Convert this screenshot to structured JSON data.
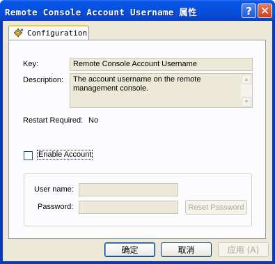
{
  "window": {
    "title": "Remote Console Account Username 属性",
    "help_glyph": "?",
    "close_glyph": "✕"
  },
  "tab": {
    "label": "Configuration",
    "icon": "gear-icon"
  },
  "fields": {
    "key_label": "Key:",
    "key_value": "Remote Console Account Username",
    "description_label": "Description:",
    "description_value": "The account username on the remote management console.",
    "restart_label": "Restart Required:",
    "restart_value": "No"
  },
  "account": {
    "enable_label": "Enable Account",
    "enabled": false,
    "username_label": "User name:",
    "username_value": "",
    "password_label": "Password:",
    "password_value": "",
    "reset_password_label": "Reset Password"
  },
  "buttons": {
    "ok": "确定",
    "cancel": "取消",
    "apply": "应用 (A)"
  },
  "colors": {
    "titlebar": "#0a55e6",
    "dialog_bg": "#ece9d8",
    "tab_highlight": "#ffc83c"
  }
}
